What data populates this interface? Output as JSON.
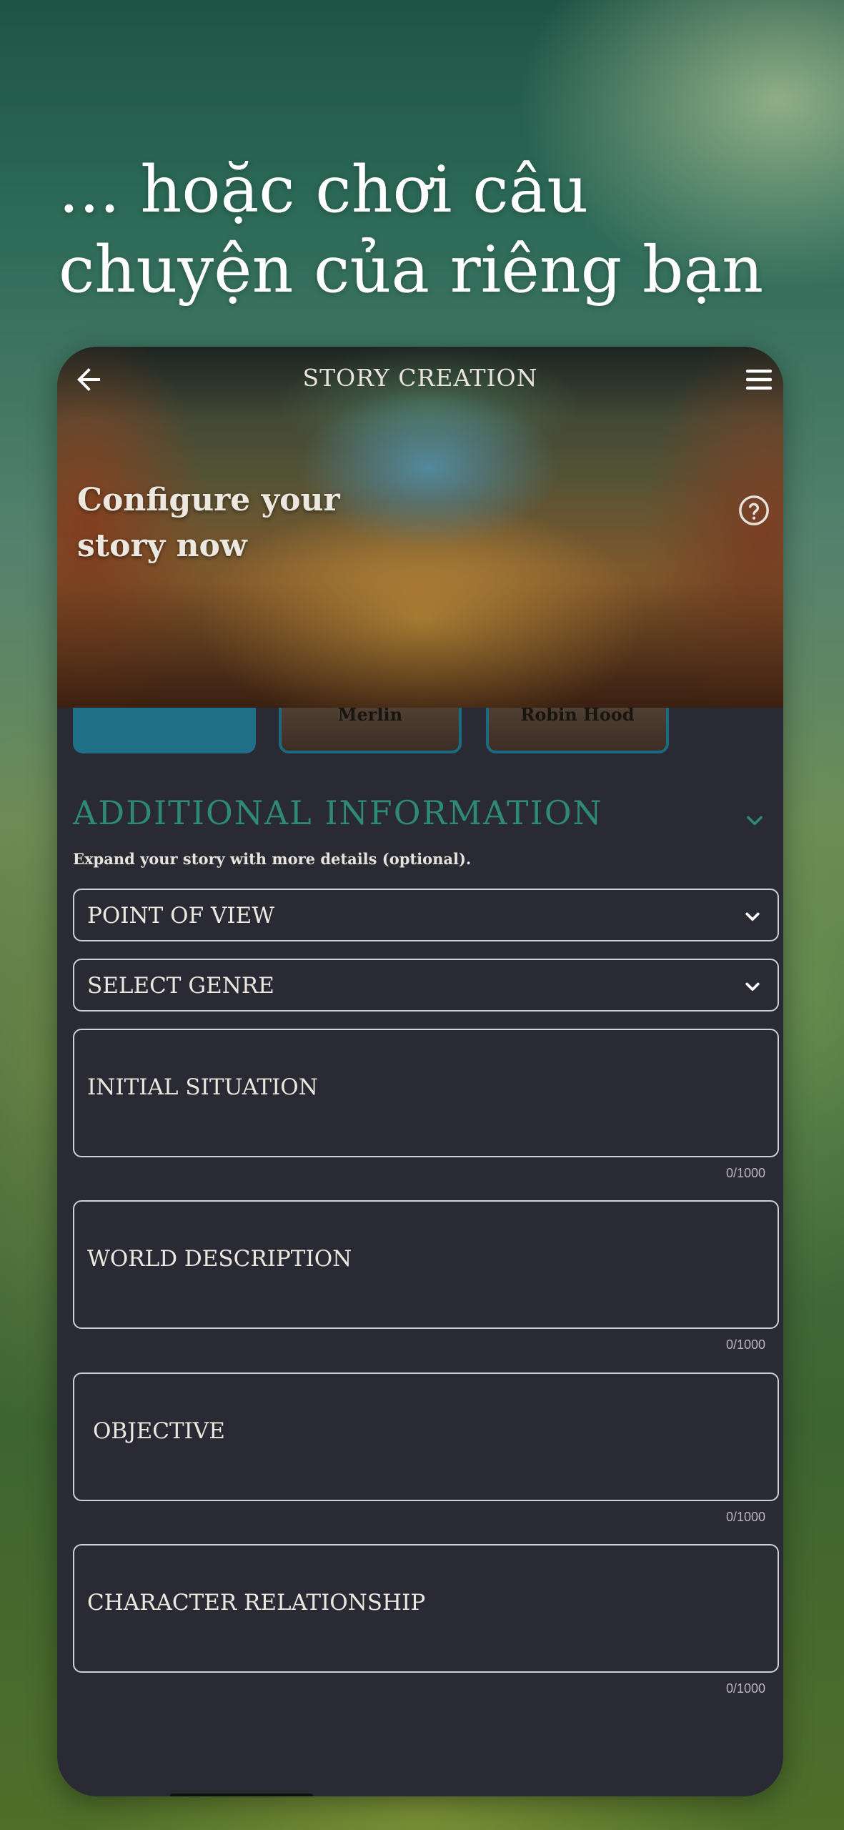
{
  "promo": {
    "line1": "... hoặc chơi câu",
    "line2": "chuyện của riêng bạn"
  },
  "app": {
    "screen_title": "STORY CREATION",
    "hero_title": "Configure your story now",
    "icons": {
      "back": "arrow-left-icon",
      "menu": "hamburger-menu-icon",
      "help": "help-circle-icon",
      "chevron": "chevron-down-icon"
    },
    "characters": [
      {
        "label": ""
      },
      {
        "label": "Merlin"
      },
      {
        "label": "Robin Hood"
      }
    ],
    "additional": {
      "title": "ADDITIONAL INFORMATION",
      "subtitle": "Expand your story with more details (optional)."
    },
    "selects": {
      "point_of_view": "POINT OF VIEW",
      "genre": "SELECT GENRE"
    },
    "fields": {
      "initial_situation": {
        "label": "INITIAL SITUATION",
        "counter": "0/1000"
      },
      "world_description": {
        "label": "WORLD DESCRIPTION",
        "counter": "0/1000"
      },
      "objective": {
        "label": "OBJECTIVE",
        "counter": "0/1000"
      },
      "character_relationship": {
        "label": "CHARACTER RELATIONSHIP",
        "counter": "0/1000"
      }
    },
    "colors": {
      "accent": "#2f8a74",
      "selected_card": "#1f6f86",
      "panel_bg": "#2a2a34"
    }
  }
}
